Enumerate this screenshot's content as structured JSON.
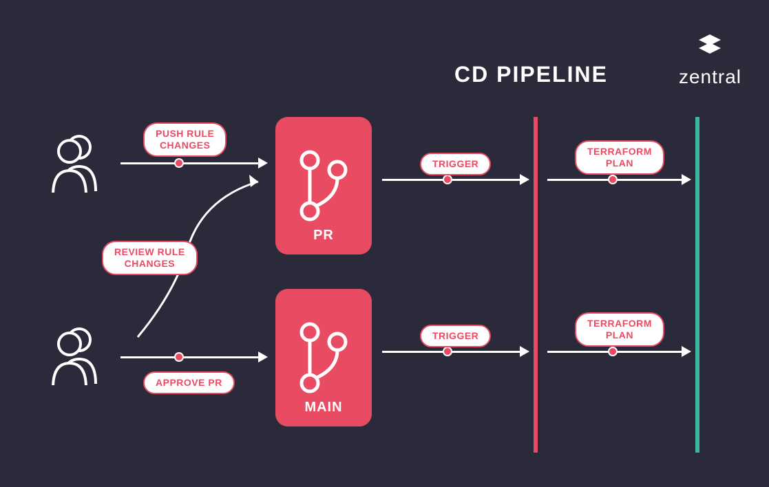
{
  "title": "CD PIPELINE",
  "brand": {
    "name": "zentral"
  },
  "users": {
    "top": {
      "icon": "users-icon"
    },
    "bottom": {
      "icon": "users-icon"
    }
  },
  "git": {
    "pr": {
      "label": "PR",
      "icon": "git-branch-icon"
    },
    "main": {
      "label": "MAIN",
      "icon": "git-branch-icon"
    }
  },
  "labels": {
    "push": "PUSH RULE\nCHANGES",
    "review": "REVIEW RULE\nCHANGES",
    "approve": "APPROVE PR",
    "trigger1": "TRIGGER",
    "trigger2": "TRIGGER",
    "tfplan1": "TERRAFORM\nPLAN",
    "tfplan2": "TERRAFORM\nPLAN"
  },
  "colors": {
    "accent": "#e94b63",
    "teal": "#3bb6a0",
    "bg": "#2a2a3a"
  }
}
